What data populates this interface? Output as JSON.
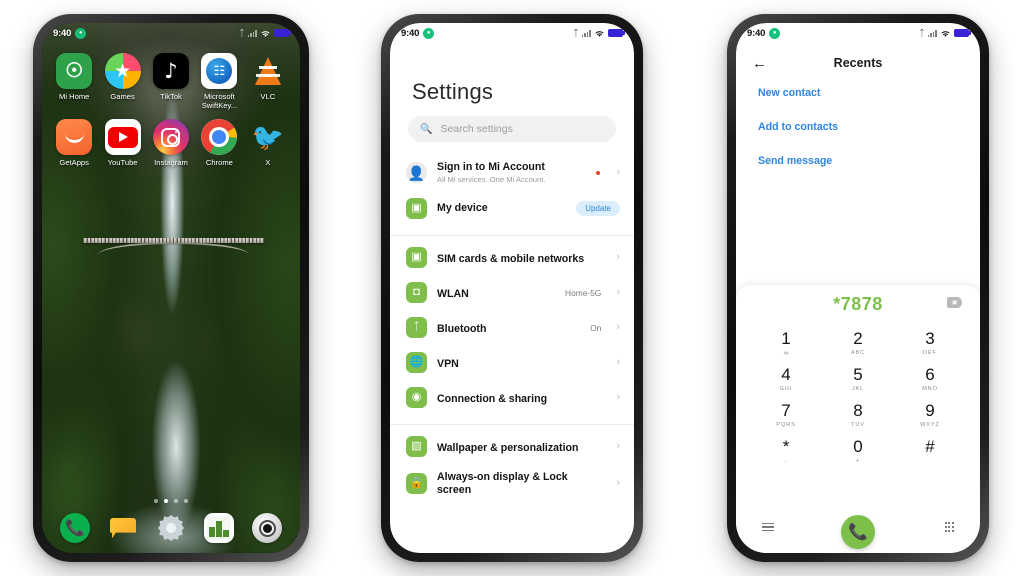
{
  "status_bar": {
    "time": "9:40",
    "badge_icon": "shield-badge-icon",
    "bluetooth_icon": "bluetooth-icon",
    "signal_icon": "cellular-signal-icon",
    "wifi_icon": "wifi-icon",
    "battery_icon": "battery-icon",
    "battery_color": "#3a22d6"
  },
  "phone1": {
    "name": "home-screen",
    "apps_row1": [
      {
        "label": "Mi Home",
        "icon": "mi-home-icon"
      },
      {
        "label": "Games",
        "icon": "games-icon"
      },
      {
        "label": "TikTok",
        "icon": "tiktok-icon"
      },
      {
        "label": "Microsoft SwiftKey...",
        "icon": "microsoft-swiftkey-icon"
      },
      {
        "label": "VLC",
        "icon": "vlc-icon"
      }
    ],
    "apps_row2": [
      {
        "label": "GetApps",
        "icon": "getapps-icon"
      },
      {
        "label": "YouTube",
        "icon": "youtube-icon"
      },
      {
        "label": "Instagram",
        "icon": "instagram-icon"
      },
      {
        "label": "Chrome",
        "icon": "chrome-icon"
      },
      {
        "label": "X",
        "icon": "x-twitter-icon"
      }
    ],
    "dock": [
      {
        "icon": "phone-icon"
      },
      {
        "icon": "messages-icon"
      },
      {
        "icon": "settings-gear-icon"
      },
      {
        "icon": "file-manager-icon"
      },
      {
        "icon": "camera-icon"
      }
    ],
    "page_dots": {
      "count": 4,
      "active_index": 1
    },
    "wallpaper": "waterfall-bridge-wallpaper"
  },
  "phone2": {
    "name": "settings-screen",
    "title": "Settings",
    "search": {
      "placeholder": "Search settings",
      "icon": "search-icon"
    },
    "account_group": [
      {
        "title": "Sign in to Mi Account",
        "subtitle": "All Mi services. One Mi Account.",
        "icon": "account-avatar-icon",
        "badge": "red-dot",
        "value": "",
        "chevron": "chevron-right-icon"
      },
      {
        "title": "My device",
        "subtitle": "",
        "icon": "device-icon",
        "badge": "",
        "value": "Update",
        "chevron": ""
      }
    ],
    "connectivity_group": [
      {
        "title": "SIM cards & mobile networks",
        "value": "",
        "icon": "sim-card-icon",
        "chevron": "chevron-right-icon"
      },
      {
        "title": "WLAN",
        "value": "Home-5G",
        "icon": "wifi-icon",
        "chevron": "chevron-right-icon"
      },
      {
        "title": "Bluetooth",
        "value": "On",
        "icon": "bluetooth-icon",
        "chevron": "chevron-right-icon"
      },
      {
        "title": "VPN",
        "value": "",
        "icon": "globe-icon",
        "chevron": "chevron-right-icon"
      },
      {
        "title": "Connection & sharing",
        "value": "",
        "icon": "sharing-icon",
        "chevron": "chevron-right-icon"
      }
    ],
    "personalization_group": [
      {
        "title": "Wallpaper & personalization",
        "value": "",
        "icon": "wallpaper-icon",
        "chevron": "chevron-right-icon"
      },
      {
        "title": "Always-on display & Lock screen",
        "value": "",
        "icon": "lock-icon",
        "chevron": "chevron-right-icon"
      }
    ],
    "accent_green": "#7fbe4b",
    "update_pill_color": "#2e86d8"
  },
  "phone3": {
    "name": "dialer-screen",
    "back_icon": "back-arrow-icon",
    "title": "Recents",
    "quick_actions": [
      {
        "label": "New contact"
      },
      {
        "label": "Add to contacts"
      },
      {
        "label": "Send message"
      }
    ],
    "dialed_number": "*7878",
    "dialed_color": "#7cc04a",
    "backspace_icon": "backspace-icon",
    "keys": [
      {
        "digit": "1",
        "sub": "∞",
        "sub_is_voicemail": true
      },
      {
        "digit": "2",
        "sub": "ABC"
      },
      {
        "digit": "3",
        "sub": "DEF"
      },
      {
        "digit": "4",
        "sub": "GHI"
      },
      {
        "digit": "5",
        "sub": "JKL"
      },
      {
        "digit": "6",
        "sub": "MNO"
      },
      {
        "digit": "7",
        "sub": "PQRS"
      },
      {
        "digit": "8",
        "sub": "TUV"
      },
      {
        "digit": "9",
        "sub": "WXYZ"
      },
      {
        "digit": "*",
        "sub": ","
      },
      {
        "digit": "0",
        "sub": "+"
      },
      {
        "digit": "#",
        "sub": ""
      }
    ],
    "bottom_bar": {
      "left_icon": "menu-list-icon",
      "call_icon": "call-button-icon",
      "right_icon": "keypad-grid-icon"
    },
    "call_button_color": "#7cc04a",
    "link_color": "#2f86e0"
  }
}
